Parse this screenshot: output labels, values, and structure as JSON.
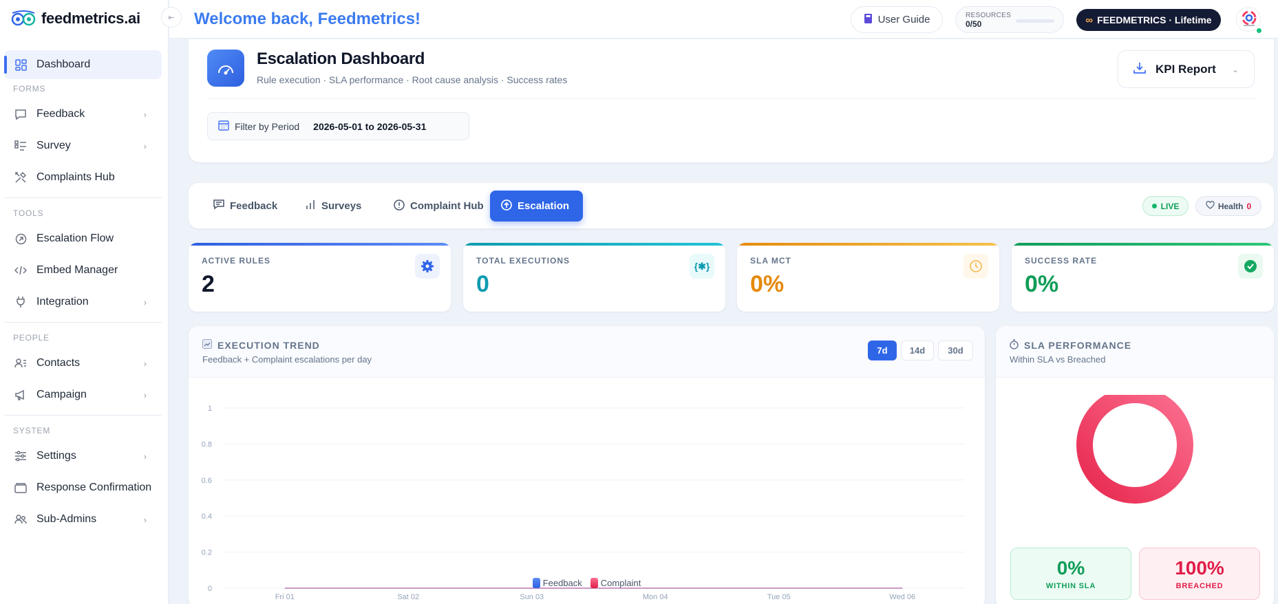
{
  "brand": {
    "name": "feedmetrics.ai",
    "welcome": "Welcome back, Feedmetrics!"
  },
  "topbar": {
    "user_guide": "User Guide",
    "resources_label": "RESOURCES",
    "resources_value": "0/50",
    "resources_fraction": 0,
    "plan": "FEEDMETRICS · Lifetime"
  },
  "sidebar": {
    "dashboard": "Dashboard",
    "sections": {
      "forms": "FORMS",
      "tools": "TOOLS",
      "people": "PEOPLE",
      "system": "SYSTEM"
    },
    "items": {
      "feedback": "Feedback",
      "survey": "Survey",
      "complaints_hub": "Complaints Hub",
      "escalation_flow": "Escalation Flow",
      "embed_manager": "Embed Manager",
      "integration": "Integration",
      "contacts": "Contacts",
      "campaign": "Campaign",
      "settings": "Settings",
      "response_confirmation": "Response Confirmation",
      "sub_admins": "Sub-Admins"
    }
  },
  "header": {
    "title": "Escalation Dashboard",
    "subtitle": "Rule execution · SLA performance · Root cause analysis · Success rates",
    "kpi_report": "KPI Report",
    "filter_label": "Filter by Period",
    "filter_value": "2026-05-01 to 2026-05-31"
  },
  "tabs": {
    "feedback": "Feedback",
    "surveys": "Surveys",
    "complaint_hub": "Complaint Hub",
    "escalation": "Escalation",
    "live": "LIVE",
    "health_label": "Health",
    "health_value": "0"
  },
  "stats": {
    "active_rules": {
      "label": "ACTIVE RULES",
      "value": "2"
    },
    "total_executions": {
      "label": "TOTAL EXECUTIONS",
      "value": "0"
    },
    "sla_mct": {
      "label": "SLA MCT",
      "value": "0%"
    },
    "success_rate": {
      "label": "SUCCESS RATE",
      "value": "0%"
    }
  },
  "trend": {
    "title": "EXECUTION TREND",
    "subtitle": "Feedback + Complaint escalations per day",
    "ranges": [
      "7d",
      "14d",
      "30d"
    ],
    "active_range": "7d"
  },
  "sla": {
    "title": "SLA PERFORMANCE",
    "subtitle": "Within SLA vs Breached",
    "within_value": "0%",
    "within_label": "WITHIN SLA",
    "breached_value": "100%",
    "breached_label": "BREACHED"
  },
  "colors": {
    "accent": "#2f66e8",
    "feedback_series": "#3b6ef0",
    "complaint_series": "#f43f6a",
    "active_rules": "#2f66e8",
    "total_executions": "#0e9bb0",
    "sla_mct": "#e58a0c",
    "success_rate": "#0f9d58"
  },
  "chart_data": [
    {
      "type": "line",
      "categories": [
        "Fri 01",
        "Sat 02",
        "Sun 03",
        "Mon 04",
        "Tue 05",
        "Wed 06"
      ],
      "series": [
        {
          "name": "Feedback",
          "values": [
            0,
            0,
            0,
            0,
            0,
            0
          ]
        },
        {
          "name": "Complaint",
          "values": [
            0,
            0,
            0,
            0,
            0,
            0
          ]
        }
      ],
      "yticks": [
        "0",
        "0.2",
        "0.4",
        "0.6",
        "0.8",
        "1"
      ],
      "ylim": [
        0,
        1
      ],
      "grid": true,
      "legend": "bottom-center"
    },
    {
      "type": "pie",
      "labels": [
        "Within SLA",
        "Breached"
      ],
      "values": [
        0,
        100
      ]
    }
  ]
}
